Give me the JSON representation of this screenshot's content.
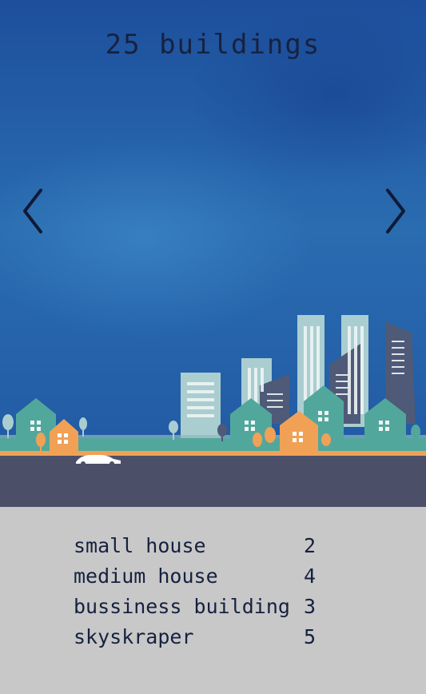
{
  "header": {
    "title": "25 buildings"
  },
  "nav": {
    "prev": "prev-arrow",
    "next": "next-arrow"
  },
  "stats": [
    {
      "label": "small house",
      "count": "2"
    },
    {
      "label": "medium house",
      "count": "4"
    },
    {
      "label": "bussiness building",
      "count": "3"
    },
    {
      "label": "skyskraper",
      "count": "5"
    }
  ],
  "colors": {
    "sky": "#2460a8",
    "road": "#4b5068",
    "teal": "#52a79c",
    "orange": "#f0a156",
    "panel": "#c8c8c8",
    "text": "#16213f"
  }
}
